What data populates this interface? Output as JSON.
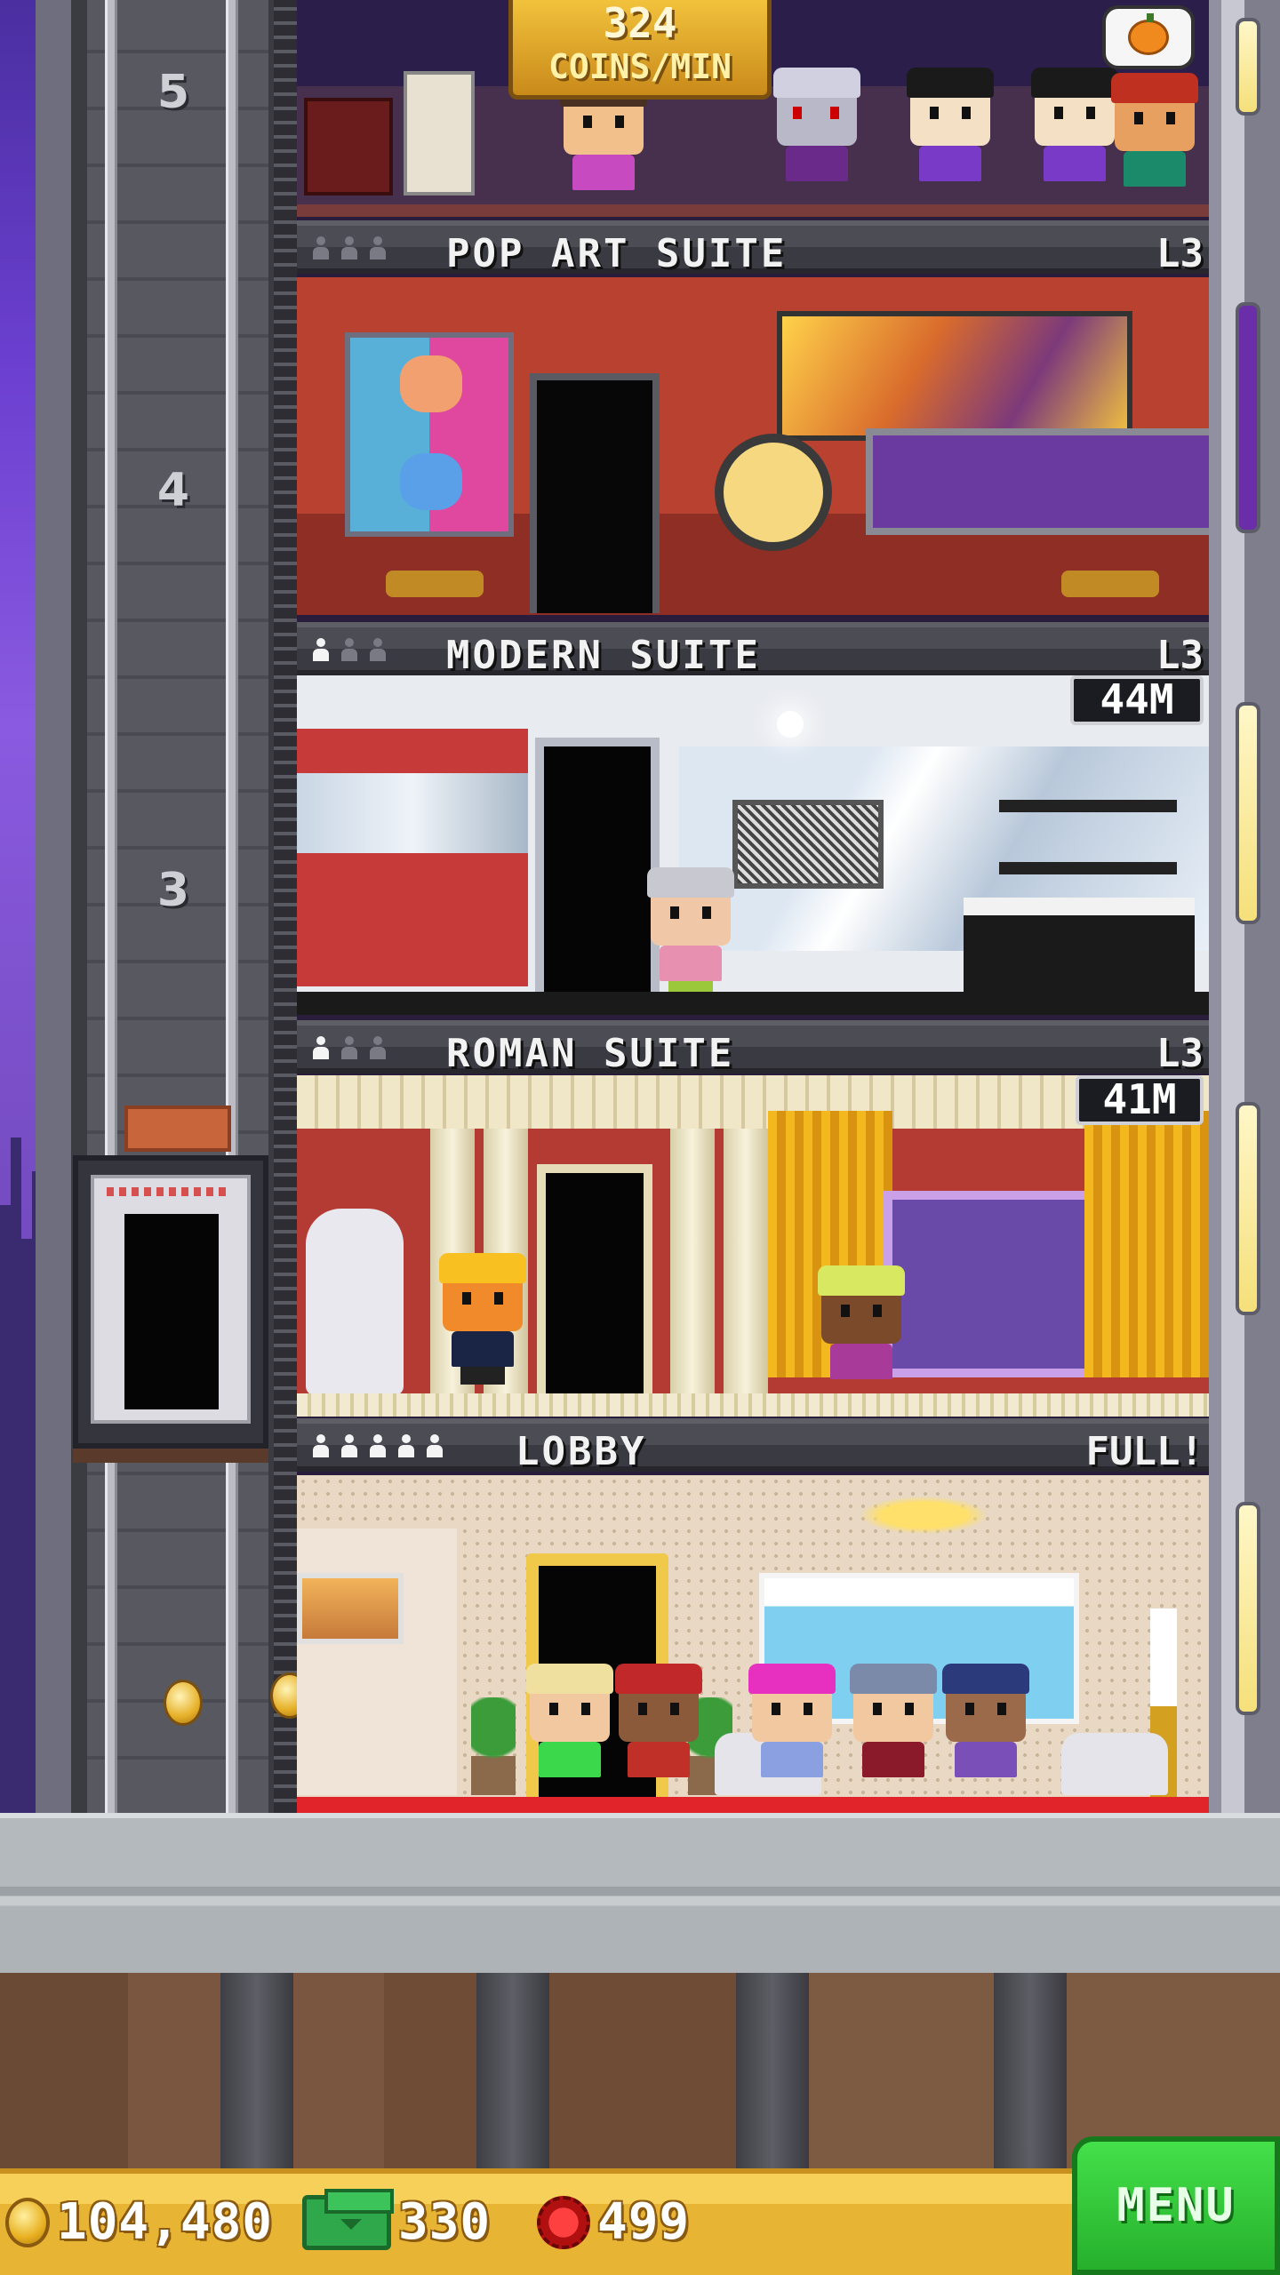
{
  "top_floor": {
    "coins_rate": "324",
    "coins_unit": "COINS/MIN",
    "bubble_icon": "pumpkin-icon"
  },
  "floors": [
    {
      "name": "POP ART SUITE",
      "level": "L3",
      "residents": 0,
      "capacity": 3
    },
    {
      "name": "MODERN SUITE",
      "level": "L3",
      "residents": 1,
      "capacity": 3,
      "timer": "44M"
    },
    {
      "name": "ROMAN SUITE",
      "level": "L3",
      "residents": 1,
      "capacity": 3,
      "timer": "41M"
    },
    {
      "name": "LOBBY",
      "level": "FULL!",
      "residents": 5,
      "capacity": 5
    }
  ],
  "elevator": {
    "floor_numbers": [
      "5",
      "4",
      "3"
    ]
  },
  "hud": {
    "coins": "104,480",
    "bux": "330",
    "gems": "499",
    "menu_label": "MENU"
  },
  "colors": {
    "hud_gold": "#e8b434",
    "menu_green": "#26b02c",
    "label_text": "#f2f2f2",
    "lobby_carpet": "#e0242a"
  }
}
